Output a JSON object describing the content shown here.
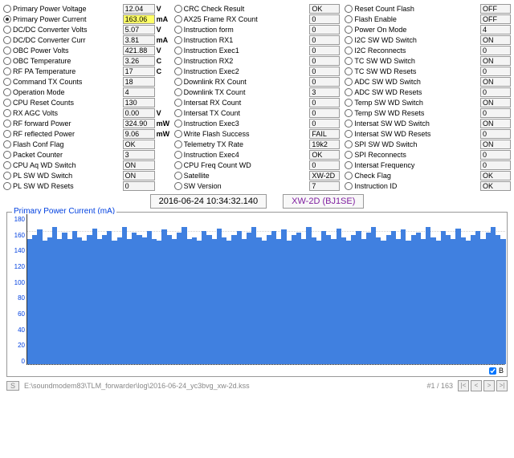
{
  "col1": [
    {
      "label": "Primary Power Voltage",
      "val": "12.04",
      "unit": "V",
      "sel": false
    },
    {
      "label": "Primary Power Current",
      "val": "163.06",
      "unit": "mA",
      "sel": true,
      "hl": true
    },
    {
      "label": "DC/DC Converter Volts",
      "val": "5.07",
      "unit": "V",
      "sel": false
    },
    {
      "label": "DC/DC Converter Curr",
      "val": "3.81",
      "unit": "mA",
      "sel": false
    },
    {
      "label": "OBC Power Volts",
      "val": "421.88",
      "unit": "V",
      "sel": false
    },
    {
      "label": "OBC Temperature",
      "val": "3.26",
      "unit": "C",
      "sel": false
    },
    {
      "label": "RF PA Temperature",
      "val": "17",
      "unit": "C",
      "sel": false
    },
    {
      "label": "Command TX Counts",
      "val": "18",
      "unit": "",
      "sel": false
    },
    {
      "label": "Operation Mode",
      "val": "4",
      "unit": "",
      "sel": false
    },
    {
      "label": "CPU Reset Counts",
      "val": "130",
      "unit": "",
      "sel": false
    },
    {
      "label": "RX AGC Volts",
      "val": "0.00",
      "unit": "V",
      "sel": false
    },
    {
      "label": "RF forward Power",
      "val": "324.90",
      "unit": "mW",
      "sel": false
    },
    {
      "label": "RF reflected Power",
      "val": "9.06",
      "unit": "mW",
      "sel": false
    },
    {
      "label": "Flash Conf Flag",
      "val": "OK",
      "unit": "",
      "sel": false
    },
    {
      "label": "Packet Counter",
      "val": "3",
      "unit": "",
      "sel": false
    },
    {
      "label": "CPU Aq WD Switch",
      "val": "ON",
      "unit": "",
      "sel": false
    },
    {
      "label": "PL SW WD Switch",
      "val": "ON",
      "unit": "",
      "sel": false
    },
    {
      "label": "PL SW WD Resets",
      "val": "0",
      "unit": "",
      "sel": false
    }
  ],
  "col2": [
    {
      "label": "CRC Check Result",
      "val": "OK"
    },
    {
      "label": "AX25 Frame RX Count",
      "val": "0"
    },
    {
      "label": "Instruction form",
      "val": "0"
    },
    {
      "label": "Instruction RX1",
      "val": "0"
    },
    {
      "label": "Instruction Exec1",
      "val": "0"
    },
    {
      "label": "Instruction RX2",
      "val": "0"
    },
    {
      "label": "Instruction Exec2",
      "val": "0"
    },
    {
      "label": "Downlink RX Count",
      "val": "0"
    },
    {
      "label": "Downlink TX Count",
      "val": "3"
    },
    {
      "label": "Intersat RX Count",
      "val": "0"
    },
    {
      "label": "Intersat TX Count",
      "val": "0"
    },
    {
      "label": "Instruction Exec3",
      "val": "0"
    },
    {
      "label": "Write Flash Success",
      "val": "FAIL"
    },
    {
      "label": "Telemetry TX Rate",
      "val": "19k2"
    },
    {
      "label": "Instruction Exec4",
      "val": "OK"
    },
    {
      "label": "CPU Freq Count WD",
      "val": "0"
    },
    {
      "label": "Satellite",
      "val": "XW-2D"
    },
    {
      "label": "SW Version",
      "val": "7"
    }
  ],
  "col3": [
    {
      "label": "Reset Count Flash",
      "val": "OFF"
    },
    {
      "label": "Flash Enable",
      "val": "OFF"
    },
    {
      "label": "Power On Mode",
      "val": "4"
    },
    {
      "label": "I2C SW WD Switch",
      "val": "ON"
    },
    {
      "label": "I2C Reconnects",
      "val": "0"
    },
    {
      "label": "TC SW WD Switch",
      "val": "ON"
    },
    {
      "label": "TC SW WD Resets",
      "val": "0"
    },
    {
      "label": "ADC SW WD Switch",
      "val": "ON"
    },
    {
      "label": "ADC SW WD Resets",
      "val": "0"
    },
    {
      "label": "Temp SW WD Switch",
      "val": "ON"
    },
    {
      "label": "Temp SW WD Resets",
      "val": "0"
    },
    {
      "label": "Intersat SW WD Switch",
      "val": "ON"
    },
    {
      "label": "Intersat SW WD Resets",
      "val": "0"
    },
    {
      "label": "SPI SW WD Switch",
      "val": "ON"
    },
    {
      "label": "SPI Reconnects",
      "val": "0"
    },
    {
      "label": "Intersat Frequency",
      "val": "0"
    },
    {
      "label": "Check Flag",
      "val": "OK"
    },
    {
      "label": "Instruction ID",
      "val": "OK"
    }
  ],
  "timestamp": "2016-06-24 10:34:32.140",
  "sat_id": "XW-2D (BJ1SE)",
  "chart_title": "Primary Power Current (mA)",
  "chart_data": {
    "type": "bar",
    "title": "Primary Power Current (mA)",
    "xlabel": "",
    "ylabel": "",
    "ylim": [
      0,
      180
    ],
    "yticks": [
      0,
      20,
      40,
      60,
      80,
      100,
      120,
      140,
      160,
      180
    ],
    "values": [
      150,
      155,
      162,
      148,
      152,
      165,
      150,
      158,
      150,
      160,
      152,
      148,
      155,
      163,
      150,
      155,
      160,
      148,
      152,
      165,
      150,
      158,
      155,
      152,
      160,
      150,
      148,
      162,
      155,
      150,
      158,
      165,
      150,
      152,
      148,
      160,
      155,
      150,
      163,
      152,
      148,
      155,
      160,
      150,
      158,
      165,
      152,
      148,
      155,
      160,
      150,
      162,
      148,
      155,
      158,
      150,
      165,
      152,
      148,
      160,
      155,
      150,
      163,
      152,
      148,
      155,
      160,
      150,
      158,
      165,
      152,
      148,
      155,
      160,
      150,
      162,
      148,
      155,
      158,
      150,
      165,
      152,
      148,
      160,
      155,
      150,
      163,
      152,
      148,
      155,
      160,
      150,
      158,
      165,
      155,
      150
    ]
  },
  "yticks": [
    "180",
    "160",
    "140",
    "120",
    "100",
    "80",
    "60",
    "40",
    "20",
    "0"
  ],
  "checkbox_b": "B",
  "footer_path": "E:\\soundmodem83\\TLM_forwarder\\log\\2016-06-24_yc3bvg_xw-2d.kss",
  "pager": "#1 / 163",
  "btn_s": "S"
}
